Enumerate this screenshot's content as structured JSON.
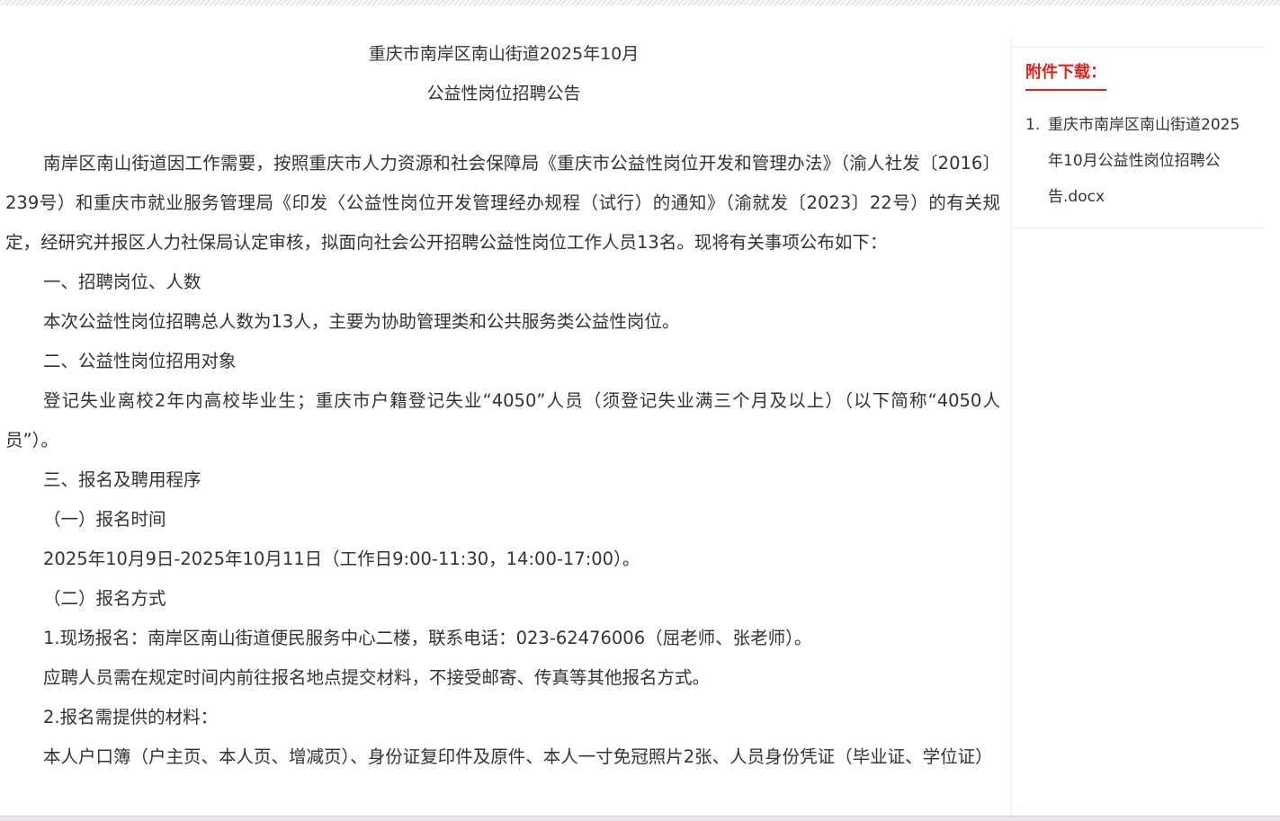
{
  "article": {
    "title_line1": "重庆市南岸区南山街道2025年10月",
    "title_line2": "公益性岗位招聘公告",
    "paragraphs": [
      "南岸区南山街道因工作需要，按照重庆市人力资源和社会保障局《重庆市公益性岗位开发和管理办法》（渝人社发〔2016〕239号）和重庆市就业服务管理局《印发〈公益性岗位开发管理经办规程（试行）的通知》（渝就发〔2023〕22号）的有关规定，经研究并报区人力社保局认定审核，拟面向社会公开招聘公益性岗位工作人员13名。现将有关事项公布如下：",
      "一、招聘岗位、人数",
      "本次公益性岗位招聘总人数为13人，主要为协助管理类和公共服务类公益性岗位。",
      "二、公益性岗位招用对象",
      "登记失业离校2年内高校毕业生；重庆市户籍登记失业“4050”人员（须登记失业满三个月及以上）（以下简称“4050人员”）。",
      "三、报名及聘用程序",
      "（一）报名时间",
      "2025年10月9日-2025年10月11日（工作日9:00-11:30，14:00-17:00）。",
      "（二）报名方式",
      "1.现场报名：南岸区南山街道便民服务中心二楼，联系电话：023-62476006（屈老师、张老师）。",
      "应聘人员需在规定时间内前往报名地点提交材料，不接受邮寄、传真等其他报名方式。",
      "2.报名需提供的材料：",
      "本人户口簿（户主页、本人页、增减页）、身份证复印件及原件、本人一寸免冠照片2张、人员身份凭证（毕业证、学位证）"
    ]
  },
  "sidebar": {
    "heading": "附件下载：",
    "attachments": [
      {
        "index": "1.",
        "name": "重庆市南岸区南山街道2025年10月公益性岗位招聘公告.docx"
      }
    ]
  },
  "colors": {
    "accent": "#e0221b",
    "text": "#333333"
  }
}
